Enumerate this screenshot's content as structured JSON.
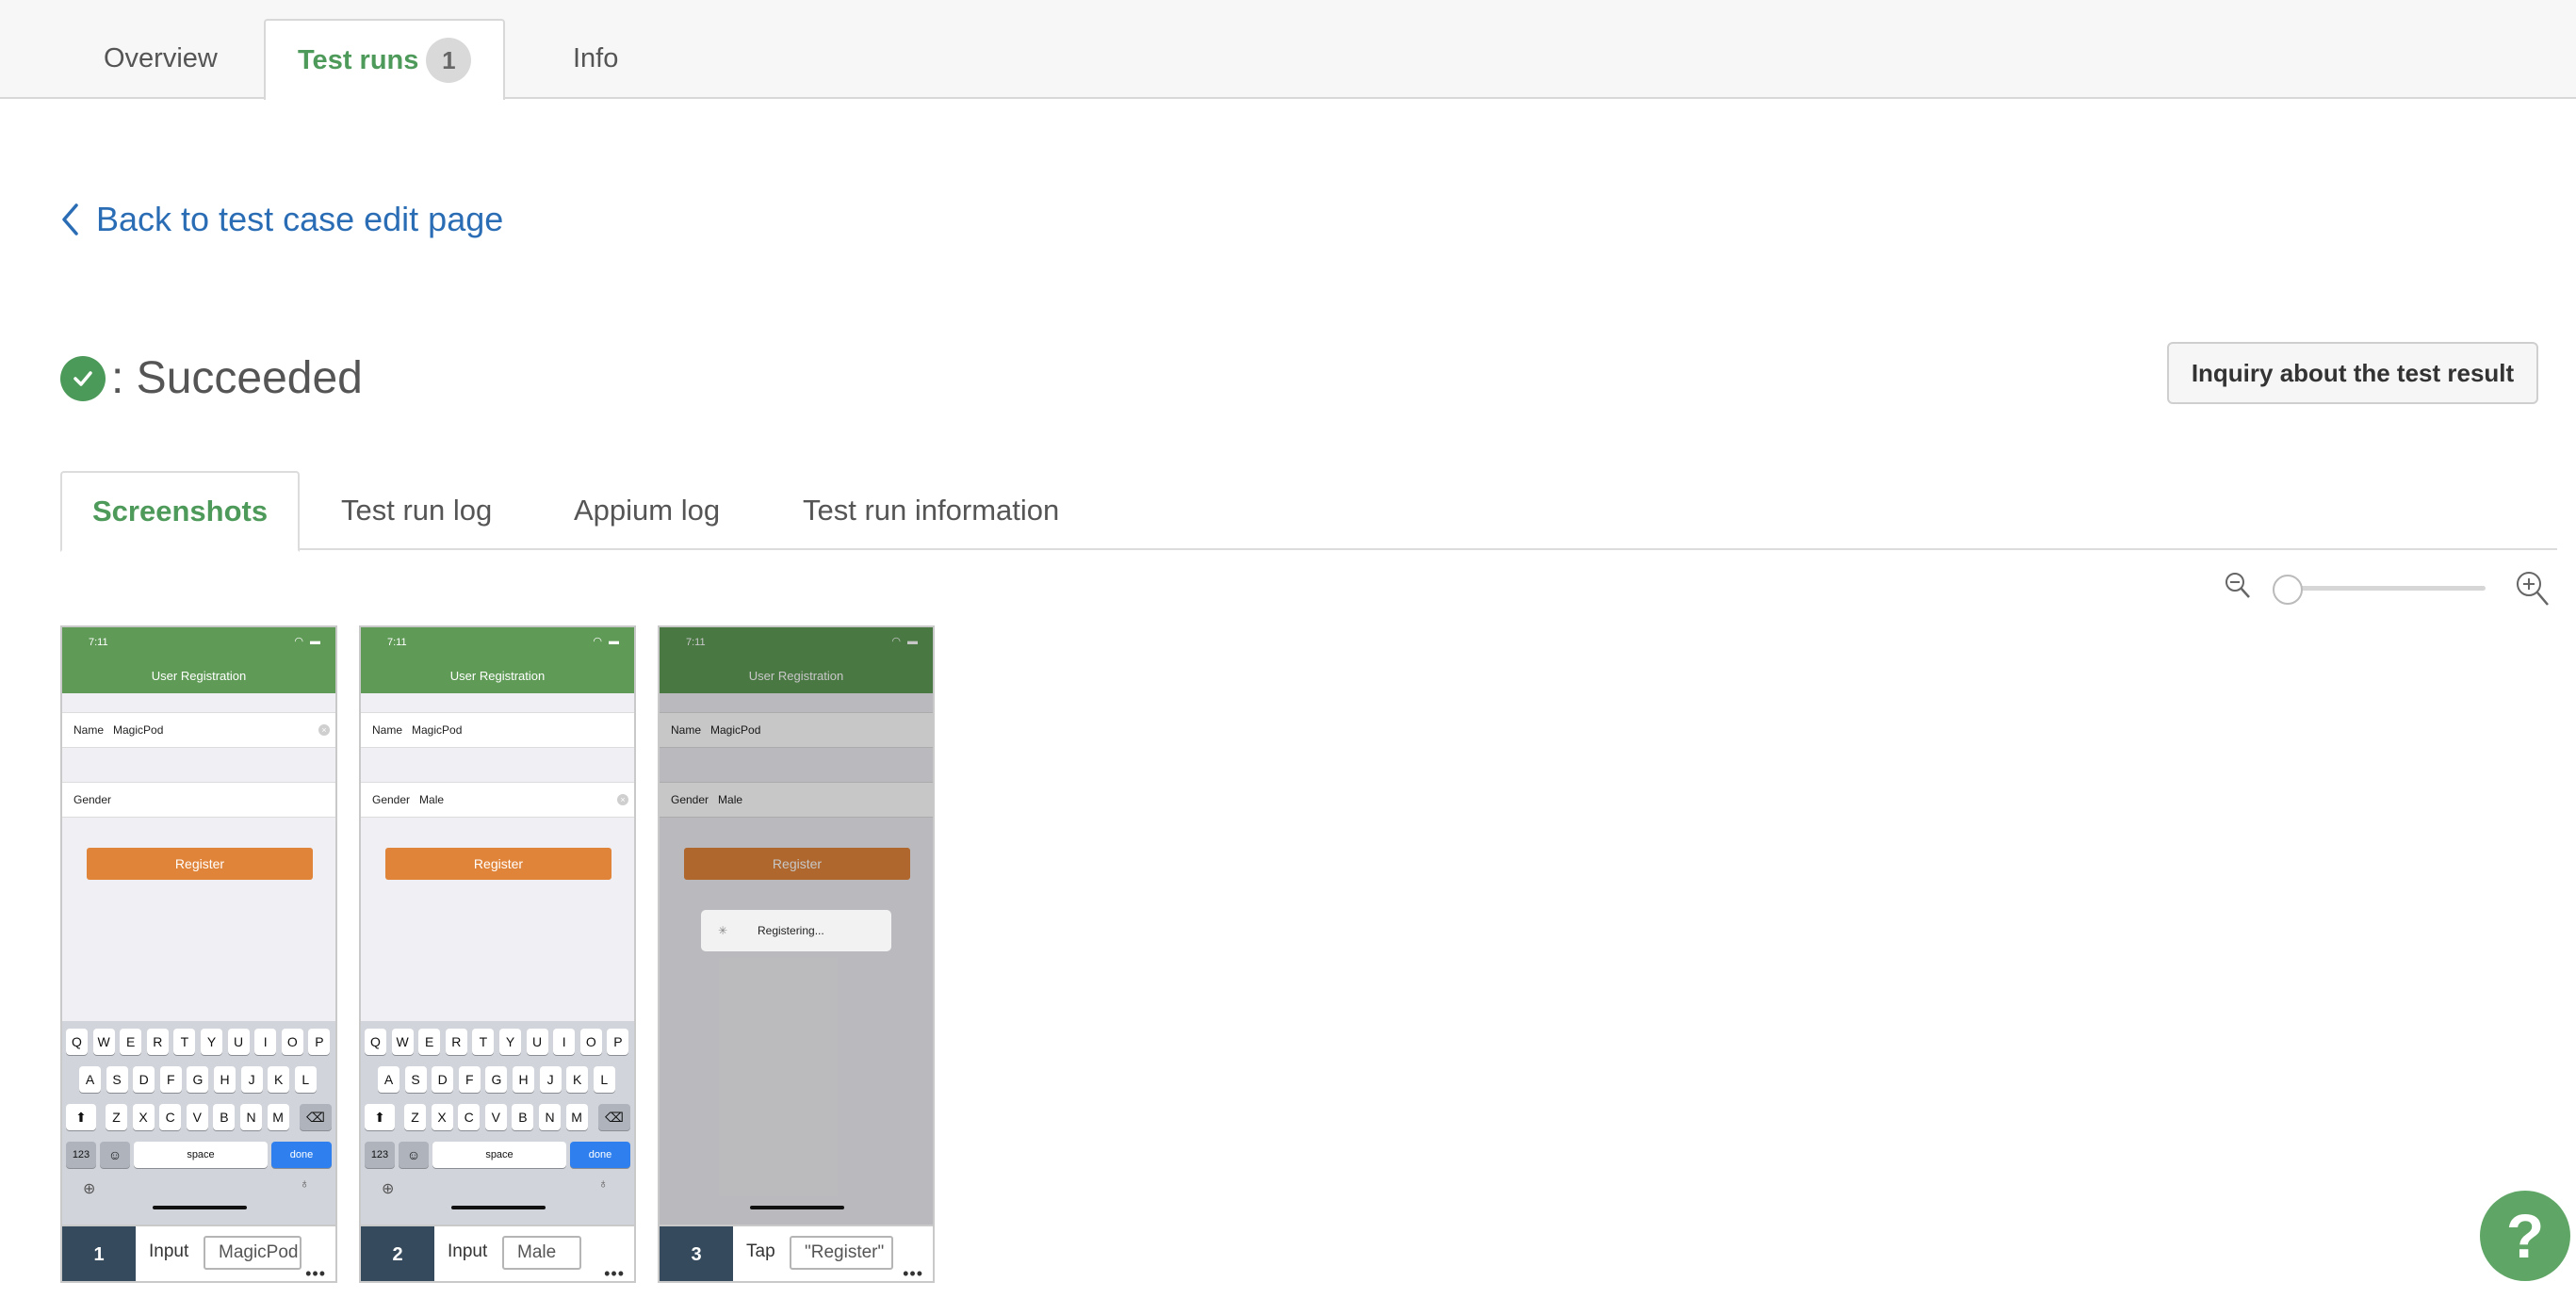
{
  "top_tabs": [
    {
      "label": "Overview"
    },
    {
      "label": "Test runs",
      "badge": "1",
      "active": true
    },
    {
      "label": "Info"
    }
  ],
  "back_link": "Back to test case edit page",
  "status": {
    "text": ": Succeeded",
    "color": "#4c9a5a"
  },
  "inquiry_button": "Inquiry about the test result",
  "sub_tabs": [
    {
      "label": "Screenshots",
      "active": true
    },
    {
      "label": "Test run log"
    },
    {
      "label": "Appium log"
    },
    {
      "label": "Test run information"
    }
  ],
  "zoom": {
    "out_icon": "zoom-out-icon",
    "in_icon": "zoom-in-icon",
    "level": 0
  },
  "screenshots": [
    {
      "time": "7:11",
      "title": "User Registration",
      "name_label": "Name",
      "name_value": "MagicPod",
      "gender_label": "Gender",
      "gender_value": "",
      "register": "Register",
      "step": {
        "number": "1",
        "action": "Input",
        "value": "MagicPod"
      }
    },
    {
      "time": "7:11",
      "title": "User Registration",
      "name_label": "Name",
      "name_value": "MagicPod",
      "gender_label": "Gender",
      "gender_value": "Male",
      "register": "Register",
      "step": {
        "number": "2",
        "action": "Input",
        "value": "Male"
      }
    },
    {
      "time": "7:11",
      "title": "User Registration",
      "name_label": "Name",
      "name_value": "MagicPod",
      "gender_label": "Gender",
      "gender_value": "Male",
      "register": "Register",
      "hud": "Registering...",
      "step": {
        "number": "3",
        "action": "Tap",
        "value": "\"Register\""
      }
    }
  ],
  "keyboard": {
    "row1": [
      "Q",
      "W",
      "E",
      "R",
      "T",
      "Y",
      "U",
      "I",
      "O",
      "P"
    ],
    "row2": [
      "A",
      "S",
      "D",
      "F",
      "G",
      "H",
      "J",
      "K",
      "L"
    ],
    "row3": [
      "Z",
      "X",
      "C",
      "V",
      "B",
      "N",
      "M"
    ],
    "numbers_key": "123",
    "space_key": "space",
    "done_key": "done"
  },
  "help_button": "?",
  "colors": {
    "accent": "#4e9a5a",
    "link": "#2a6db5",
    "step_dark": "#354a5c",
    "register_orange": "#e0843a"
  }
}
